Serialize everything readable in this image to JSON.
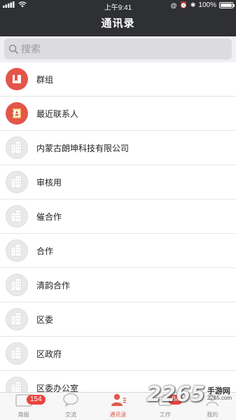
{
  "status_bar": {
    "time": "上午9:41",
    "battery": "100%",
    "battery_level": 1.0
  },
  "nav": {
    "title": "通讯录"
  },
  "search": {
    "placeholder": "搜索"
  },
  "contacts": [
    {
      "label": "群组",
      "icon": "bookmark-icon",
      "style": "red"
    },
    {
      "label": "最近联系人",
      "icon": "address-book-icon",
      "style": "red"
    },
    {
      "label": "内蒙古朗坤科技有限公司",
      "icon": "building-icon",
      "style": "gray"
    },
    {
      "label": "审核用",
      "icon": "building-icon",
      "style": "gray"
    },
    {
      "label": "催合作",
      "icon": "building-icon",
      "style": "gray"
    },
    {
      "label": "合作",
      "icon": "building-icon",
      "style": "gray"
    },
    {
      "label": "清韵合作",
      "icon": "building-icon",
      "style": "gray"
    },
    {
      "label": "区委",
      "icon": "building-icon",
      "style": "gray"
    },
    {
      "label": "区政府",
      "icon": "building-icon",
      "style": "gray"
    },
    {
      "label": "区委办公室",
      "icon": "building-icon",
      "style": "gray"
    }
  ],
  "tabbar": {
    "tabs": [
      {
        "label": "简报",
        "badge": "154",
        "icon": "briefing-icon",
        "active": false
      },
      {
        "label": "交流",
        "badge": "",
        "icon": "chat-bubble-icon",
        "active": false
      },
      {
        "label": "通讯录",
        "badge": "",
        "icon": "contacts-icon",
        "active": true
      },
      {
        "label": "工作",
        "badge": "84",
        "icon": "work-icon",
        "active": false
      },
      {
        "label": "我的",
        "badge": "",
        "icon": "profile-icon",
        "active": false
      }
    ]
  },
  "watermark": {
    "number": "2265",
    "text": "手游网",
    "url": "2265.com"
  },
  "colors": {
    "header_bg": "#2f3033",
    "accent_red": "#e4554a",
    "badge_red": "#e9453d",
    "active_tab": "#e05a4a"
  }
}
